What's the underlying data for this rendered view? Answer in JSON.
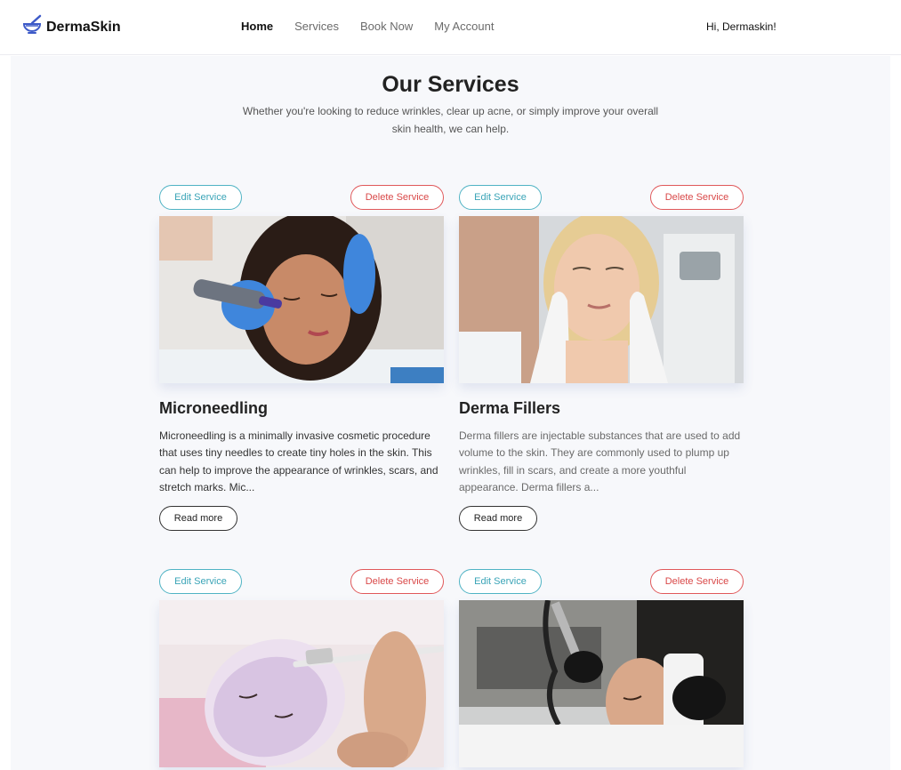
{
  "header": {
    "brand": "DermaSkin",
    "nav": [
      "Home",
      "Services",
      "Book Now",
      "My Account"
    ],
    "greeting": "Hi, Dermaskin!"
  },
  "main": {
    "title": "Our Services",
    "subtitle": "Whether you're looking to reduce wrinkles, clear up acne, or simply improve your overall skin health, we can help."
  },
  "cards": [
    {
      "edit_label": "Edit Service",
      "delete_label": "Delete Service",
      "title": "Microneedling",
      "description": "Microneedling is a minimally invasive cosmetic procedure that uses tiny needles to create tiny holes in the skin. This can help to improve the appearance of wrinkles, scars, and stretch marks. Mic...",
      "read_more": "Read more"
    },
    {
      "edit_label": "Edit Service",
      "delete_label": "Delete Service",
      "title": "Derma Fillers",
      "description": "Derma fillers are injectable substances that are used to add volume to the skin. They are commonly used to plump up wrinkles, fill in scars, and create a more youthful appearance. Derma fillers a...",
      "read_more": "Read more"
    },
    {
      "edit_label": "Edit Service",
      "delete_label": "Delete Service"
    },
    {
      "edit_label": "Edit Service",
      "delete_label": "Delete Service"
    }
  ],
  "colors": {
    "edit_accent": "#4fb3c4",
    "delete_accent": "#e0585a",
    "logo_accent": "#3d5ac8",
    "page_bg": "#f7f8fb"
  },
  "icons": {
    "logo": "mortar-pestle-icon"
  }
}
